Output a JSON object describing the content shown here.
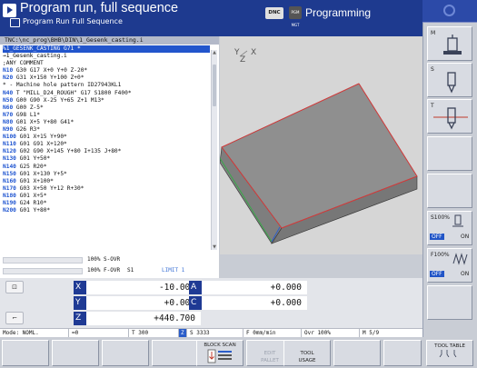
{
  "header": {
    "mode_title": "Program run, full sequence",
    "mode_subtitle": "Program Run Full Sequence",
    "dnc_label": "DNC",
    "programming_icon": "PGM MGT",
    "programming_label": "Programming"
  },
  "program": {
    "path": "TNC:\\nc_prog\\BHB\\DIN\\1_Gesenk_casting.i",
    "lines": [
      {
        "blk": "",
        "code": "%1_GESENK_CASTING G71 *",
        "cls": "active"
      },
      {
        "blk": "",
        "code": "→1_Gesenk_casting.i",
        "cls": "second"
      },
      {
        "blk": "",
        "code": ";ANY COMMENT",
        "cls": "comment"
      },
      {
        "blk": "N10",
        "code": " G30 G17 X+0 Y+0 Z-20*",
        "cls": ""
      },
      {
        "blk": "N20",
        "code": " G31 X+150 Y+100 Z+0*",
        "cls": ""
      },
      {
        "blk": "",
        "code": "* - Machine hole pattern ID27943KL1",
        "cls": ""
      },
      {
        "blk": "N40",
        "code": " T \"MILL_D24_ROUGH\" G17 S1800 F400*",
        "cls": ""
      },
      {
        "blk": "N50",
        "code": " G00 G90 X-25 Y+65 Z+1 M13*",
        "cls": ""
      },
      {
        "blk": "N60",
        "code": " G00 Z-5*",
        "cls": ""
      },
      {
        "blk": "N70",
        "code": " G98 L1*",
        "cls": ""
      },
      {
        "blk": "N80",
        "code": " G01 X+5 Y+80 G41*",
        "cls": ""
      },
      {
        "blk": "N90",
        "code": " G26 R3*",
        "cls": ""
      },
      {
        "blk": "N100",
        "code": " G01 X+15 Y+90*",
        "cls": ""
      },
      {
        "blk": "N110",
        "code": " G01 G91 X+120*",
        "cls": ""
      },
      {
        "blk": "N120",
        "code": " G02 G90 X+145 Y+80 I+135 J+80*",
        "cls": ""
      },
      {
        "blk": "N130",
        "code": " G01 Y+50*",
        "cls": ""
      },
      {
        "blk": "N140",
        "code": " G25 R20*",
        "cls": ""
      },
      {
        "blk": "N150",
        "code": " G01 X+130 Y+5*",
        "cls": ""
      },
      {
        "blk": "N160",
        "code": " G01 X+100*",
        "cls": ""
      },
      {
        "blk": "N170",
        "code": " G03 X+50 Y+12 R+30*",
        "cls": ""
      },
      {
        "blk": "N180",
        "code": " G01 X+5*",
        "cls": ""
      },
      {
        "blk": "N190",
        "code": " G24 R10*",
        "cls": ""
      },
      {
        "blk": "N200",
        "code": " G01 Y+80*",
        "cls": ""
      }
    ]
  },
  "graphic": {
    "axis_y": "Y",
    "axis_z": "Z",
    "axis_x": "X"
  },
  "overrides": {
    "s_ovr": "100% S-OVR",
    "f_ovr": "100% F-OVR",
    "f_ovr_suffix": "S1",
    "limit": "LIMIT 1"
  },
  "positions": {
    "axes": [
      {
        "label": "X",
        "value": "-10.000"
      },
      {
        "label": "Y",
        "value": "+0.000"
      },
      {
        "label": "Z",
        "value": "+440.700"
      },
      {
        "label": "A",
        "value": "+0.000"
      },
      {
        "label": "C",
        "value": "+0.000"
      }
    ]
  },
  "status": {
    "mode": "Mode: NOML.",
    "zero": "≕0",
    "tool": "T 300",
    "z_icon": "Z",
    "spindle": "S 3333",
    "feed": "F 0mm/min",
    "ovr": "Ovr 100%",
    "m": "M 5/9"
  },
  "right_softkeys": {
    "m_label": "M",
    "s_label": "S",
    "t_label": "T",
    "s_ovr_pct": "S100%",
    "f_ovr_pct": "F100%",
    "off": "OFF",
    "on": "ON"
  },
  "bottom_softkeys": {
    "block_scan": "BLOCK SCAN",
    "edit_pallet": "EDIT PALLET",
    "tool_usage": "TOOL USAGE",
    "tool_table": "TOOL TABLE"
  }
}
